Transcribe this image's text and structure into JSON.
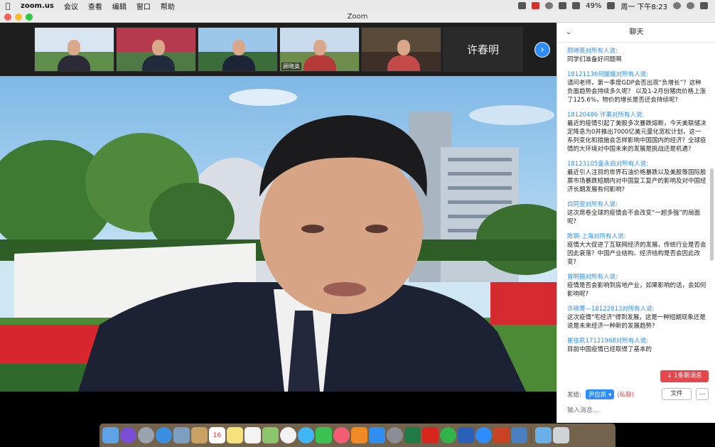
{
  "menubar": {
    "app_name": "zoom.us",
    "menus": [
      "会议",
      "查看",
      "编辑",
      "窗口",
      "帮助"
    ],
    "battery": "49%",
    "datetime": "周一 下午8:23"
  },
  "window": {
    "title": "Zoom"
  },
  "video": {
    "thumbnails": [
      {
        "name": ""
      },
      {
        "name": ""
      },
      {
        "name": ""
      },
      {
        "name": "顾晓英"
      },
      {
        "name": ""
      },
      {
        "name": "许春明"
      }
    ]
  },
  "chat": {
    "title": "聊天",
    "messages": [
      {
        "sender": "顾晓英",
        "to": "对所有人说:",
        "text": "同学们准备好问题啊"
      },
      {
        "sender": "18121136何媛媛",
        "to": "对所有人说:",
        "text": "请问老师，第一季度GDP会否出现“负增长”？这种负面趋势会持续多久呢？ 以及1-2月份猪肉价格上涨了125.6%，物价的增长是否还会持续呢?"
      },
      {
        "sender": "18120486 许乘",
        "to": "对所有人说:",
        "text": "最近的疫情引起了美股多次暴跌熔断，今天美联储决定降息为0并推出7000亿美元量化宽松计划，这一系列变化和措施会怎样影响中国国内的经济？全球疫情的大环境对中国未来的发展是挑战还是机遇?"
      },
      {
        "sender": "18123105童永启",
        "to": "对所有人说:",
        "text": "最近引人注目的世界石油价格暴跌以及美股等国际股票市场暴跌短期内对中国复工复产的影响及对中国经济长期发展有何影响?"
      },
      {
        "sender": "白同萱",
        "to": "对所有人说:",
        "text": "这次席卷全球的疫情会不会改变“一超多强”的局面呢?"
      },
      {
        "sender": "陈玥-上海",
        "to": "对所有人说:",
        "text": "疫情大大促进了互联网经济的发展，传统行业是否会因此衰落？中国产业结构、经济结构是否会因此改变?"
      },
      {
        "sender": "曾明振",
        "to": "对所有人说:",
        "text": "疫情是否会影响到房地产业，如果影响的话，会如何影响呢?"
      },
      {
        "sender": "许晓菁—18122813",
        "to": "对所有人说:",
        "text": "这次疫情\"宅经济\"得到发展，这是一种短期现象还是说是未来经济一种新的发展趋势?"
      },
      {
        "sender": "崔佳凯17121968",
        "to": "对所有人说:",
        "text": "目前中国疫情已经取得了基本的"
      }
    ],
    "new_message_badge": "↓ 1条新消息",
    "send_to_label": "发给:",
    "recipient": "尹应凯 ▾",
    "private_label": "(私聊)",
    "file_button": "文件",
    "more_button": "…",
    "input_placeholder": "输入消息..."
  },
  "dock": {
    "icons": [
      "finder-icon",
      "siri-icon",
      "launchpad-icon",
      "safari-icon",
      "preview-icon",
      "notes-icon",
      "calendar-icon",
      "stickies-icon",
      "reminders-icon",
      "maps-icon",
      "photos-icon",
      "messages-icon",
      "facetime-icon",
      "music-icon",
      "books-icon",
      "app-store-icon",
      "system-preferences-icon",
      "excel-icon",
      "acrobat-icon",
      "wechat-icon",
      "word-icon",
      "zoom-icon",
      "powerpoint-icon",
      "screen-icon",
      "folder-icon",
      "trash-icon"
    ]
  },
  "calendar_day": "16"
}
